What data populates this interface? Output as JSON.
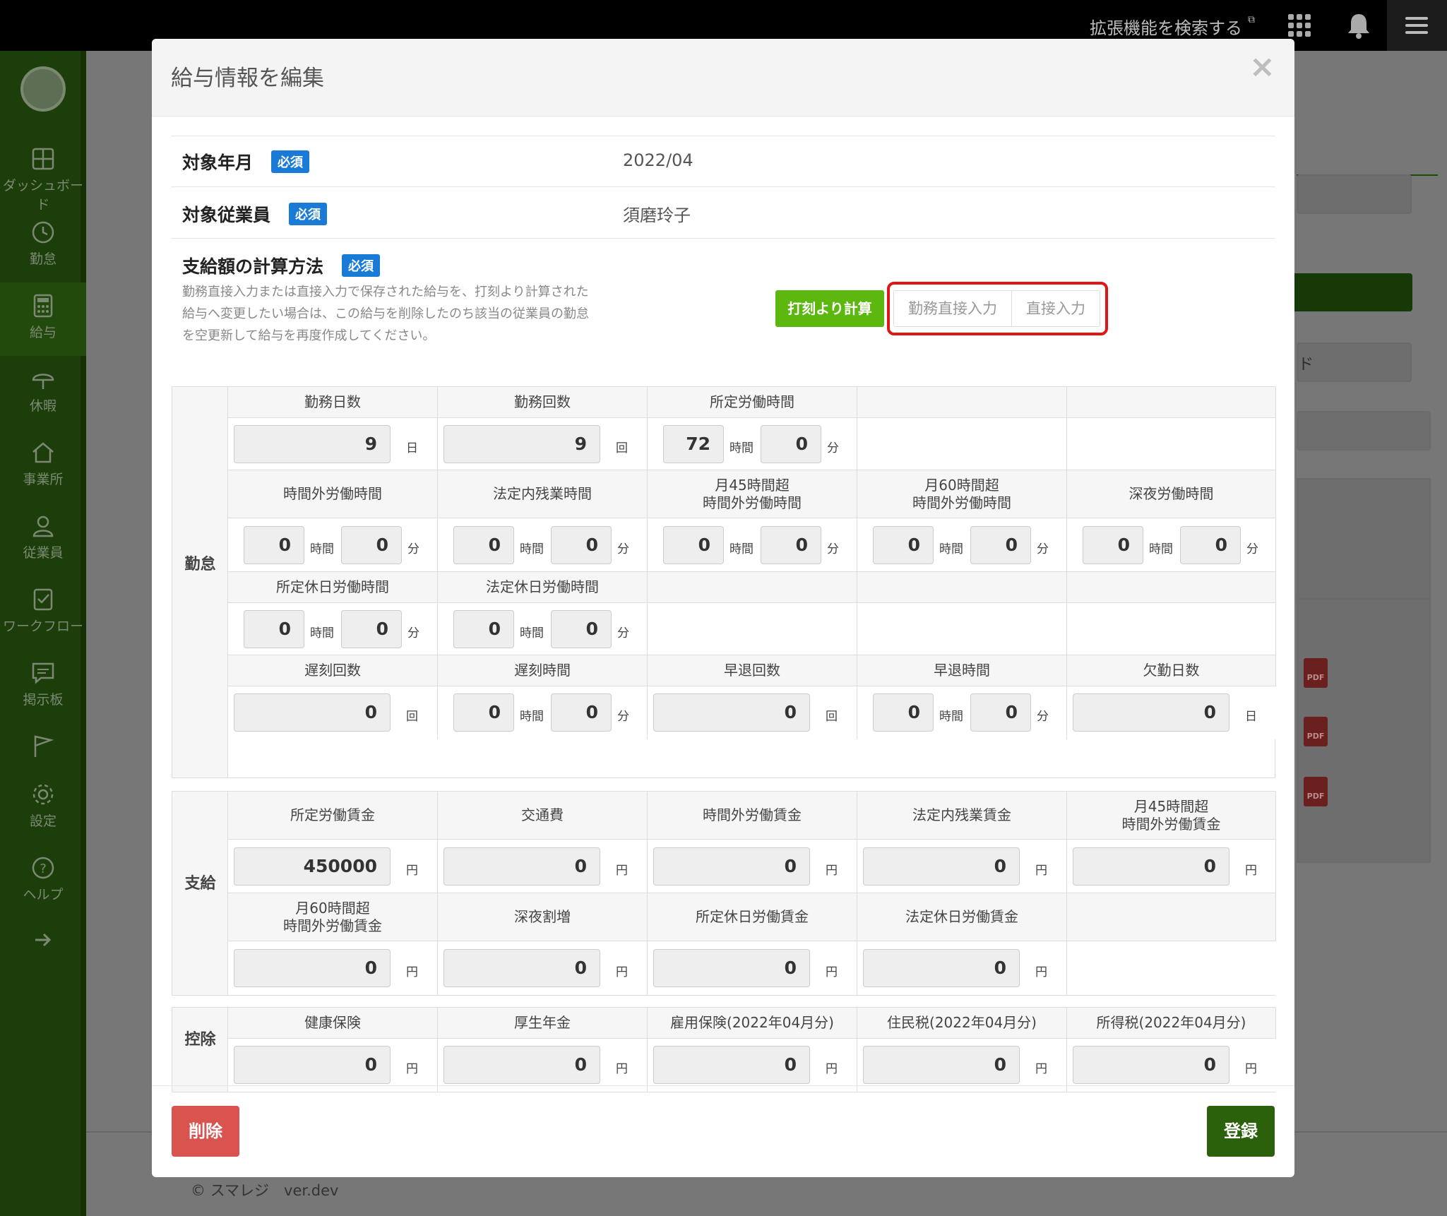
{
  "topbar": {
    "extension_search": "拡張機能を検索する",
    "icons": [
      "external-link-icon",
      "app-grid-icon",
      "bell-icon",
      "hamburger-menu-icon"
    ]
  },
  "sidebar": {
    "items": [
      {
        "label": "ダッシュボード",
        "icon": "dashboard-icon"
      },
      {
        "label": "勤怠",
        "icon": "clock-icon"
      },
      {
        "label": "給与",
        "icon": "calculator-icon",
        "active": true
      },
      {
        "label": "休暇",
        "icon": "umbrella-icon"
      },
      {
        "label": "事業所",
        "icon": "home-icon"
      },
      {
        "label": "従業員",
        "icon": "person-icon"
      },
      {
        "label": "ワークフロー",
        "icon": "checklist-icon"
      },
      {
        "label": "掲示板",
        "icon": "chat-icon"
      },
      {
        "label": "",
        "icon": "flag-icon"
      },
      {
        "label": "設定",
        "icon": "gear-icon"
      },
      {
        "label": "ヘルプ",
        "icon": "help-icon"
      },
      {
        "label": "",
        "icon": "arrow-right-icon"
      }
    ]
  },
  "background": {
    "footer": "© スマレジ　ver.dev",
    "partial_text": "ド"
  },
  "modal": {
    "title": "給与情報を編集",
    "close": "×",
    "required_badge": "必須",
    "target_month_label": "対象年月",
    "target_month_value": "2022/04",
    "target_employee_label": "対象従業員",
    "target_employee_value": "須磨玲子",
    "calc_method_label": "支給額の計算方法",
    "calc_note": "勤務直接入力または直接入力で保存された給与を、打刻より計算された給与へ変更したい場合は、この給与を削除したのち該当の従業員の勤怠を空更新して給与を再度作成してください。",
    "calc_options": [
      "打刻より計算",
      "勤務直接入力",
      "直接入力"
    ],
    "selected_calc_option": "打刻より計算",
    "units": {
      "day": "日",
      "times": "回",
      "hour": "時間",
      "minute": "分",
      "yen": "円"
    },
    "attendance": {
      "group_label": "勤怠",
      "headers": {
        "work_days": "勤務日数",
        "work_count": "勤務回数",
        "scheduled_hours": "所定労働時間",
        "overtime": "時間外労働時間",
        "legal_overtime": "法定内残業時間",
        "over45_l1": "月45時間超",
        "over45_l2": "時間外労働時間",
        "over60_l1": "月60時間超",
        "over60_l2": "時間外労働時間",
        "night": "深夜労働時間",
        "sched_holiday": "所定休日労働時間",
        "legal_holiday": "法定休日労働時間",
        "late_count": "遅刻回数",
        "late_time": "遅刻時間",
        "early_count": "早退回数",
        "early_time": "早退時間",
        "absence_days": "欠勤日数"
      },
      "values": {
        "work_days": "9",
        "work_count": "9",
        "scheduled_h": "72",
        "scheduled_m": "0",
        "overtime_h": "0",
        "overtime_m": "0",
        "legal_overtime_h": "0",
        "legal_overtime_m": "0",
        "over45_h": "0",
        "over45_m": "0",
        "over60_h": "0",
        "over60_m": "0",
        "night_h": "0",
        "night_m": "0",
        "sched_holiday_h": "0",
        "sched_holiday_m": "0",
        "legal_holiday_h": "0",
        "legal_holiday_m": "0",
        "late_count": "0",
        "late_h": "0",
        "late_m": "0",
        "early_count": "0",
        "early_h": "0",
        "early_m": "0",
        "absence_days": "0"
      }
    },
    "payment": {
      "group_label": "支給",
      "headers": {
        "scheduled_wage": "所定労働賃金",
        "commute": "交通費",
        "overtime_wage": "時間外労働賃金",
        "legal_overtime_wage": "法定内残業賃金",
        "over45_l1": "月45時間超",
        "over45_l2": "時間外労働賃金",
        "over60_l1": "月60時間超",
        "over60_l2": "時間外労働賃金",
        "night_premium": "深夜割増",
        "sched_holiday_wage": "所定休日労働賃金",
        "legal_holiday_wage": "法定休日労働賃金"
      },
      "values": {
        "scheduled_wage": "450000",
        "commute": "0",
        "overtime_wage": "0",
        "legal_overtime_wage": "0",
        "over45_wage": "0",
        "over60_wage": "0",
        "night_premium": "0",
        "sched_holiday_wage": "0",
        "legal_holiday_wage": "0"
      }
    },
    "deduction": {
      "group_label": "控除",
      "headers": {
        "health": "健康保険",
        "pension": "厚生年金",
        "employment": "雇用保険(2022年04月分)",
        "resident": "住民税(2022年04月分)",
        "income": "所得税(2022年04月分)"
      },
      "values": {
        "health": "0",
        "pension": "0",
        "employment": "0",
        "resident": "0",
        "income": "0"
      }
    },
    "delete_button": "削除",
    "save_button": "登録"
  }
}
